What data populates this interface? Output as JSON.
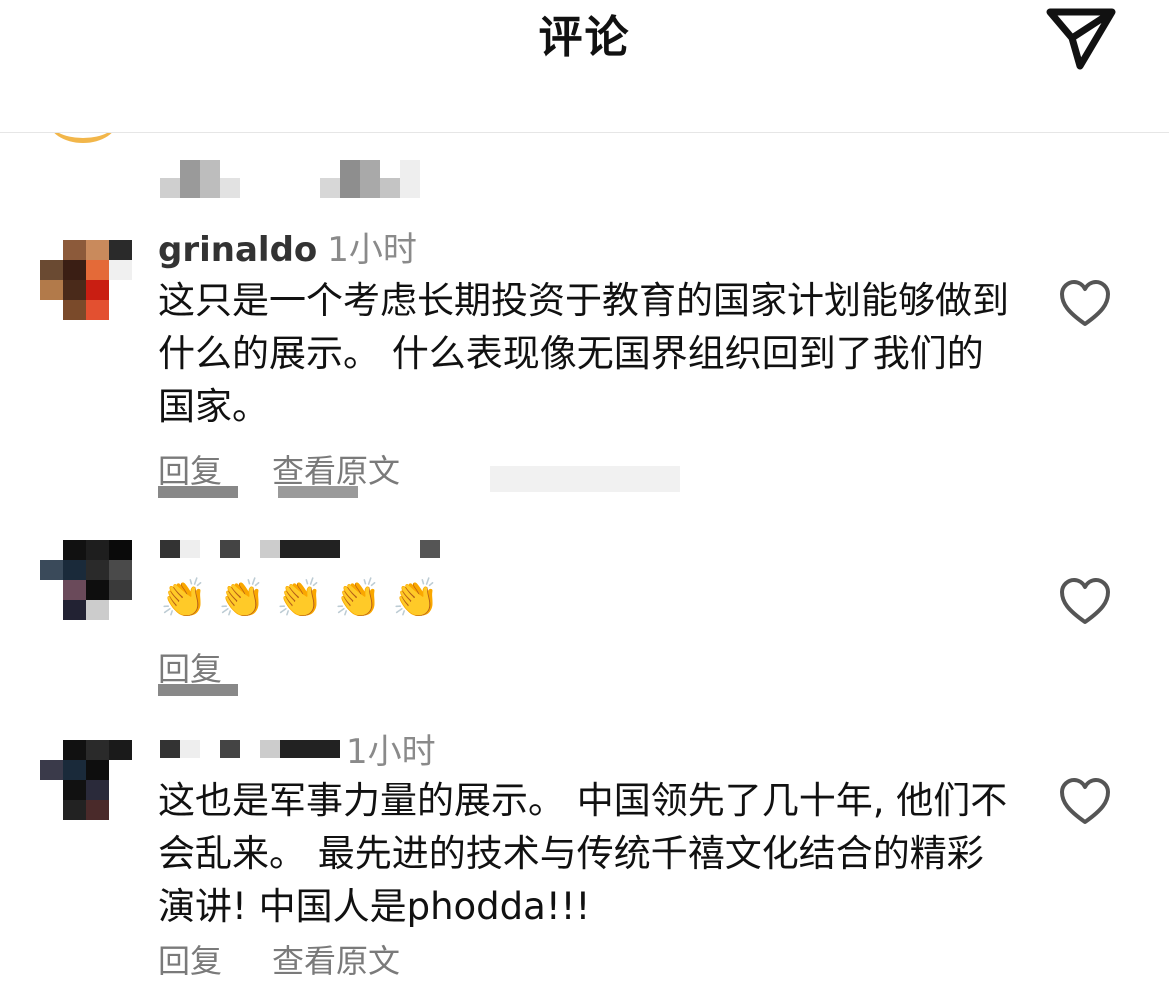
{
  "header": {
    "title": "评论",
    "share_icon": "paper-plane-icon"
  },
  "comments": [
    {
      "username": "grinaldo",
      "time": "1小时",
      "text": "这只是一个考虑长期投资于教育的国家计划能够做到什么的展示。 什么表现像无国界组织回到了我们的国家。",
      "reply_label": "回复",
      "translate_label": "查看原文"
    },
    {
      "emojis": [
        "👏",
        "👏",
        "👏",
        "👏",
        "👏"
      ],
      "reply_label": "回复"
    },
    {
      "time": "1小时",
      "text": "这也是军事力量的展示。 中国领先了几十年, 他们不会乱来。 最先进的技术与传统千禧文化结合的精彩演讲! 中国人是phodda!!!",
      "reply_label": "回复",
      "translate_label": "查看原文"
    }
  ],
  "colors": {
    "text_primary": "#111111",
    "text_secondary": "#7a7a7a",
    "icon_stroke": "#111111",
    "heart_stroke": "#555555"
  }
}
